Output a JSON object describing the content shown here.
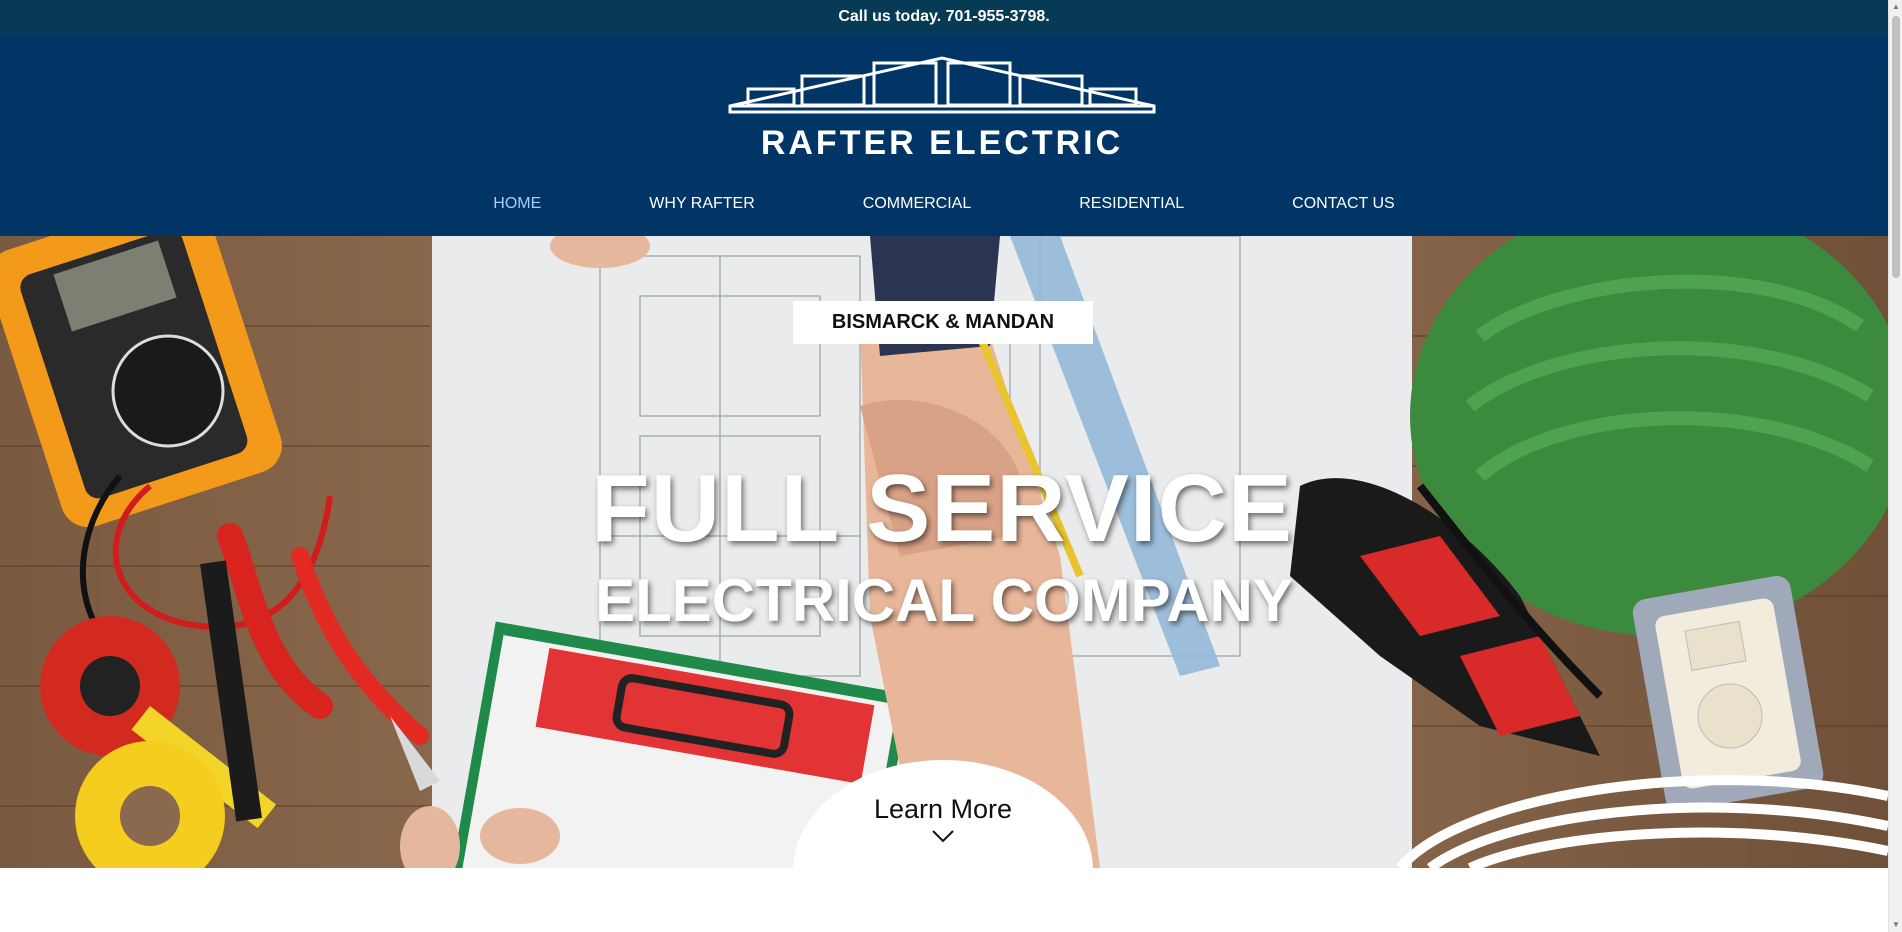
{
  "topbar": {
    "text": "Call us today. 701-955-3798."
  },
  "header": {
    "logo_text": "RAFTER ELECTRIC",
    "nav": [
      {
        "label": "HOME",
        "active": true
      },
      {
        "label": "WHY RAFTER",
        "active": false
      },
      {
        "label": "COMMERCIAL",
        "active": false
      },
      {
        "label": "RESIDENTIAL",
        "active": false
      },
      {
        "label": "CONTACT US",
        "active": false
      }
    ]
  },
  "hero": {
    "badge": "BISMARCK & MANDAN",
    "headline_line1": "FULL SERVICE",
    "headline_line2": "ELECTRICAL COMPANY",
    "learn_more": "Learn More",
    "learn_more_icon": "chevron-down-icon",
    "background_description_colors": {
      "wood": "#8a6a4e",
      "blueprint": "#e9ebec",
      "helmet": "#3c8a3e",
      "multimeter": "#f39a1b",
      "gloves": "#d92a2a"
    }
  },
  "colors": {
    "topbar_bg": "#063a55",
    "header_bg": "#013565",
    "nav_active": "#a8cdf0",
    "text_white": "#ffffff"
  }
}
